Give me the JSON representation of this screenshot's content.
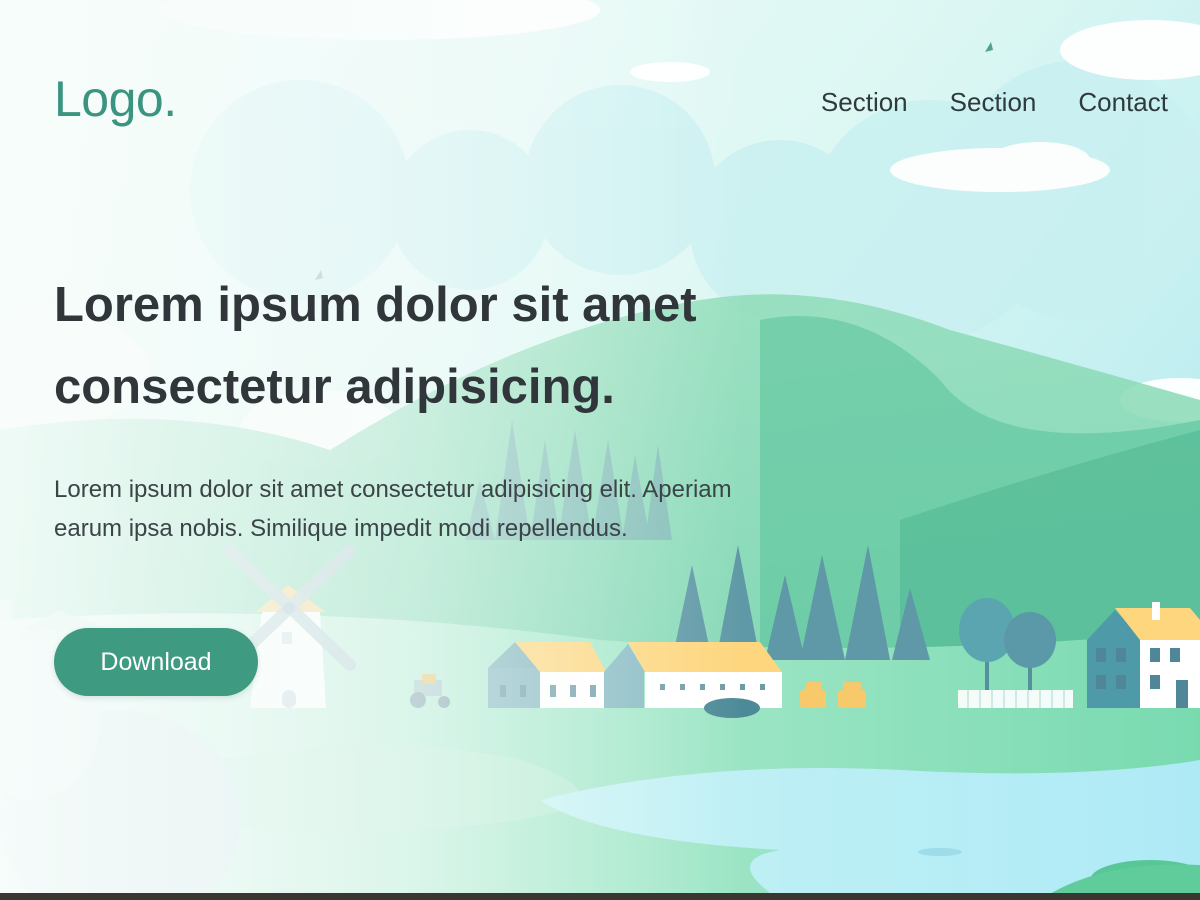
{
  "header": {
    "logo": "Logo.",
    "nav": [
      {
        "label": "Section"
      },
      {
        "label": "Section"
      },
      {
        "label": "Contact"
      }
    ]
  },
  "hero": {
    "title": "Lorem ipsum dolor sit amet consectetur adipisicing.",
    "text": "Lorem ipsum dolor sit amet consectetur adipisicing elit. Aperiam earum ipsa nobis. Similique impedit modi repellendus.",
    "cta_label": "Download"
  },
  "colors": {
    "accent": "#3e9a80",
    "logo": "#3a9480",
    "heading": "#30363a",
    "sky": "#dff7f4",
    "hill_green": "#6fd0a6",
    "water": "#b4eef5",
    "roof": "#fdd67e"
  }
}
